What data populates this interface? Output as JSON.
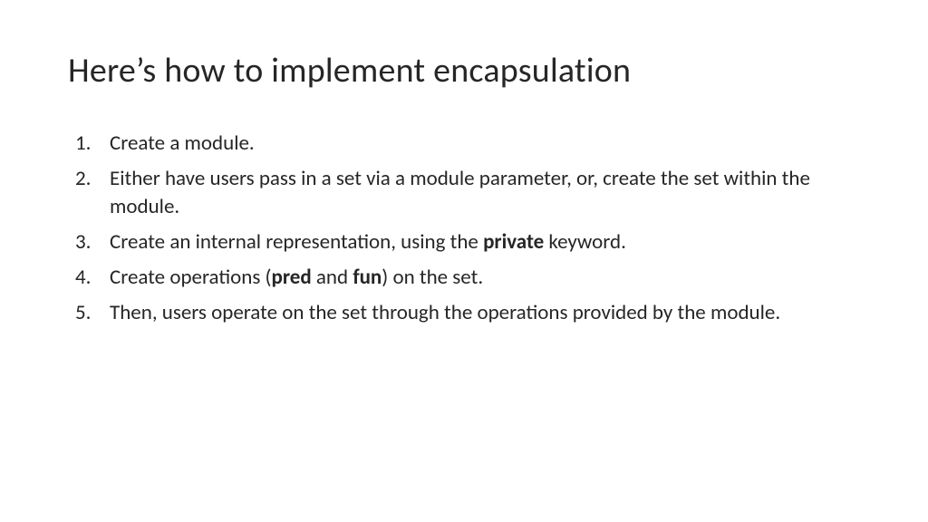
{
  "title": "Here’s how to implement encapsulation",
  "items": {
    "i1": "Create a module.",
    "i2": "Either have users pass in a set via a module parameter, or, create the set within the module.",
    "i3a": "Create an internal representation, using the ",
    "i3b": "private",
    "i3c": " keyword.",
    "i4a": "Create operations (",
    "i4b": "pred",
    "i4c": " and ",
    "i4d": "fun",
    "i4e": ") on the set.",
    "i5": "Then, users operate on the set through the operations provided by the module."
  }
}
